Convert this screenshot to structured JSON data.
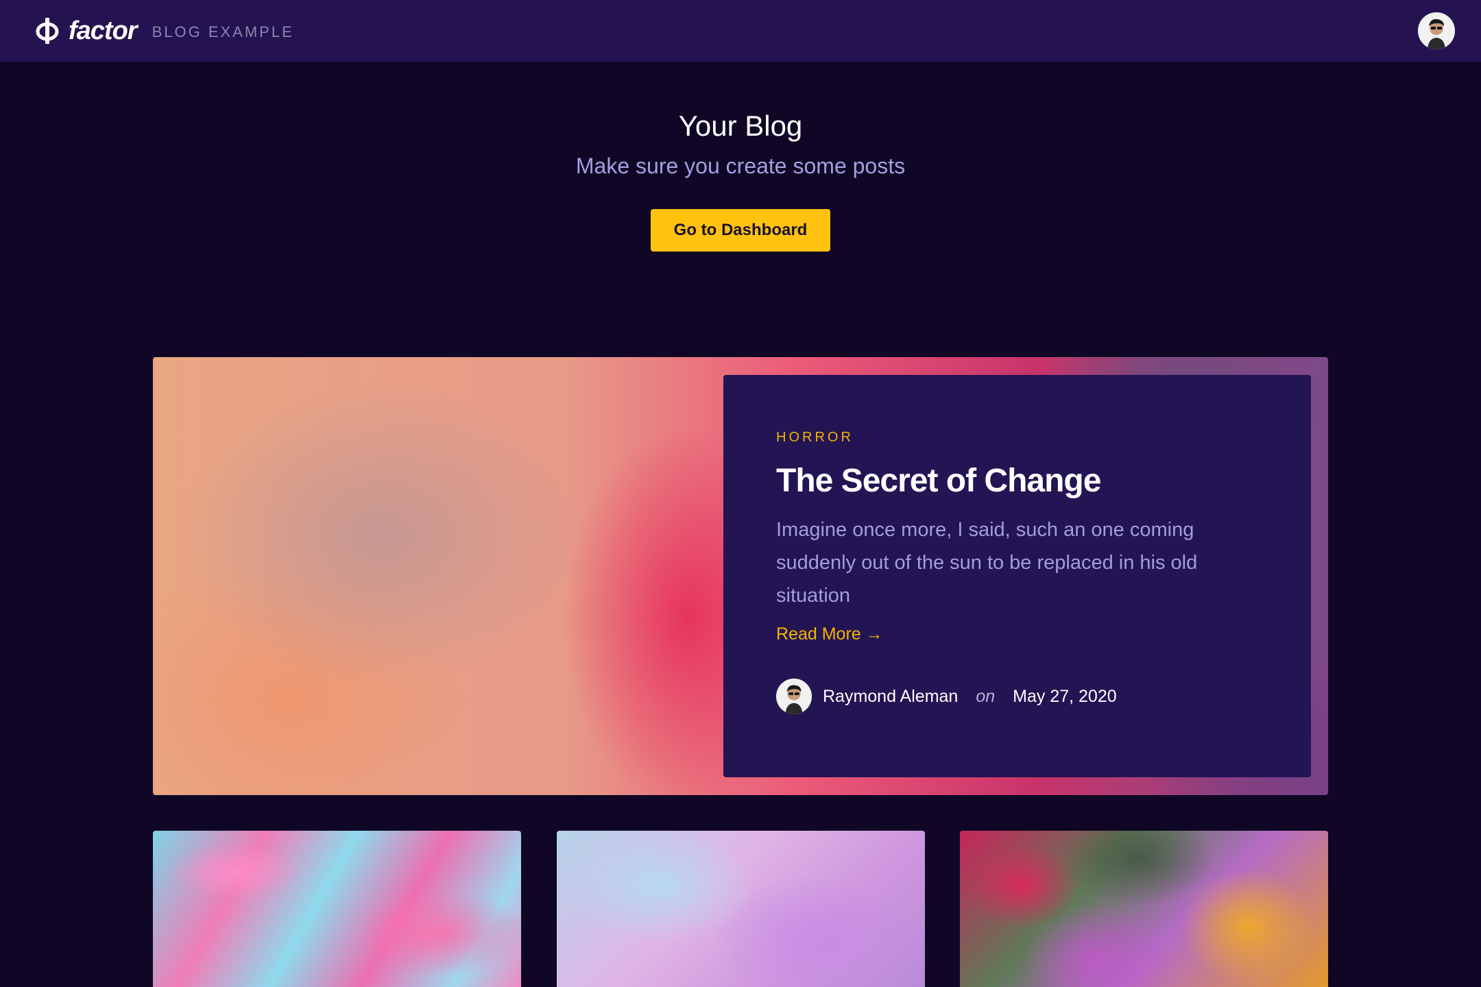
{
  "header": {
    "brand_name": "factor",
    "brand_sub": "BLOG EXAMPLE"
  },
  "hero": {
    "title": "Your Blog",
    "subtitle": "Make sure you create some posts",
    "button_label": "Go to Dashboard"
  },
  "featured": {
    "category": "HORROR",
    "title": "The Secret of Change",
    "excerpt": "Imagine once more, I said, such an one coming suddenly out of the sun to be replaced in his old situation",
    "read_more": "Read More →",
    "author": "Raymond Aleman",
    "on": "on",
    "date": "May 27, 2020"
  },
  "icons": {
    "brand": "phi-logo-icon",
    "avatar": "user-avatar-icon"
  },
  "colors": {
    "header_bg": "#241350",
    "page_bg": "#0f0725",
    "card_bg": "#231454",
    "accent": "#ffc20e",
    "muted": "#a39ddb"
  }
}
